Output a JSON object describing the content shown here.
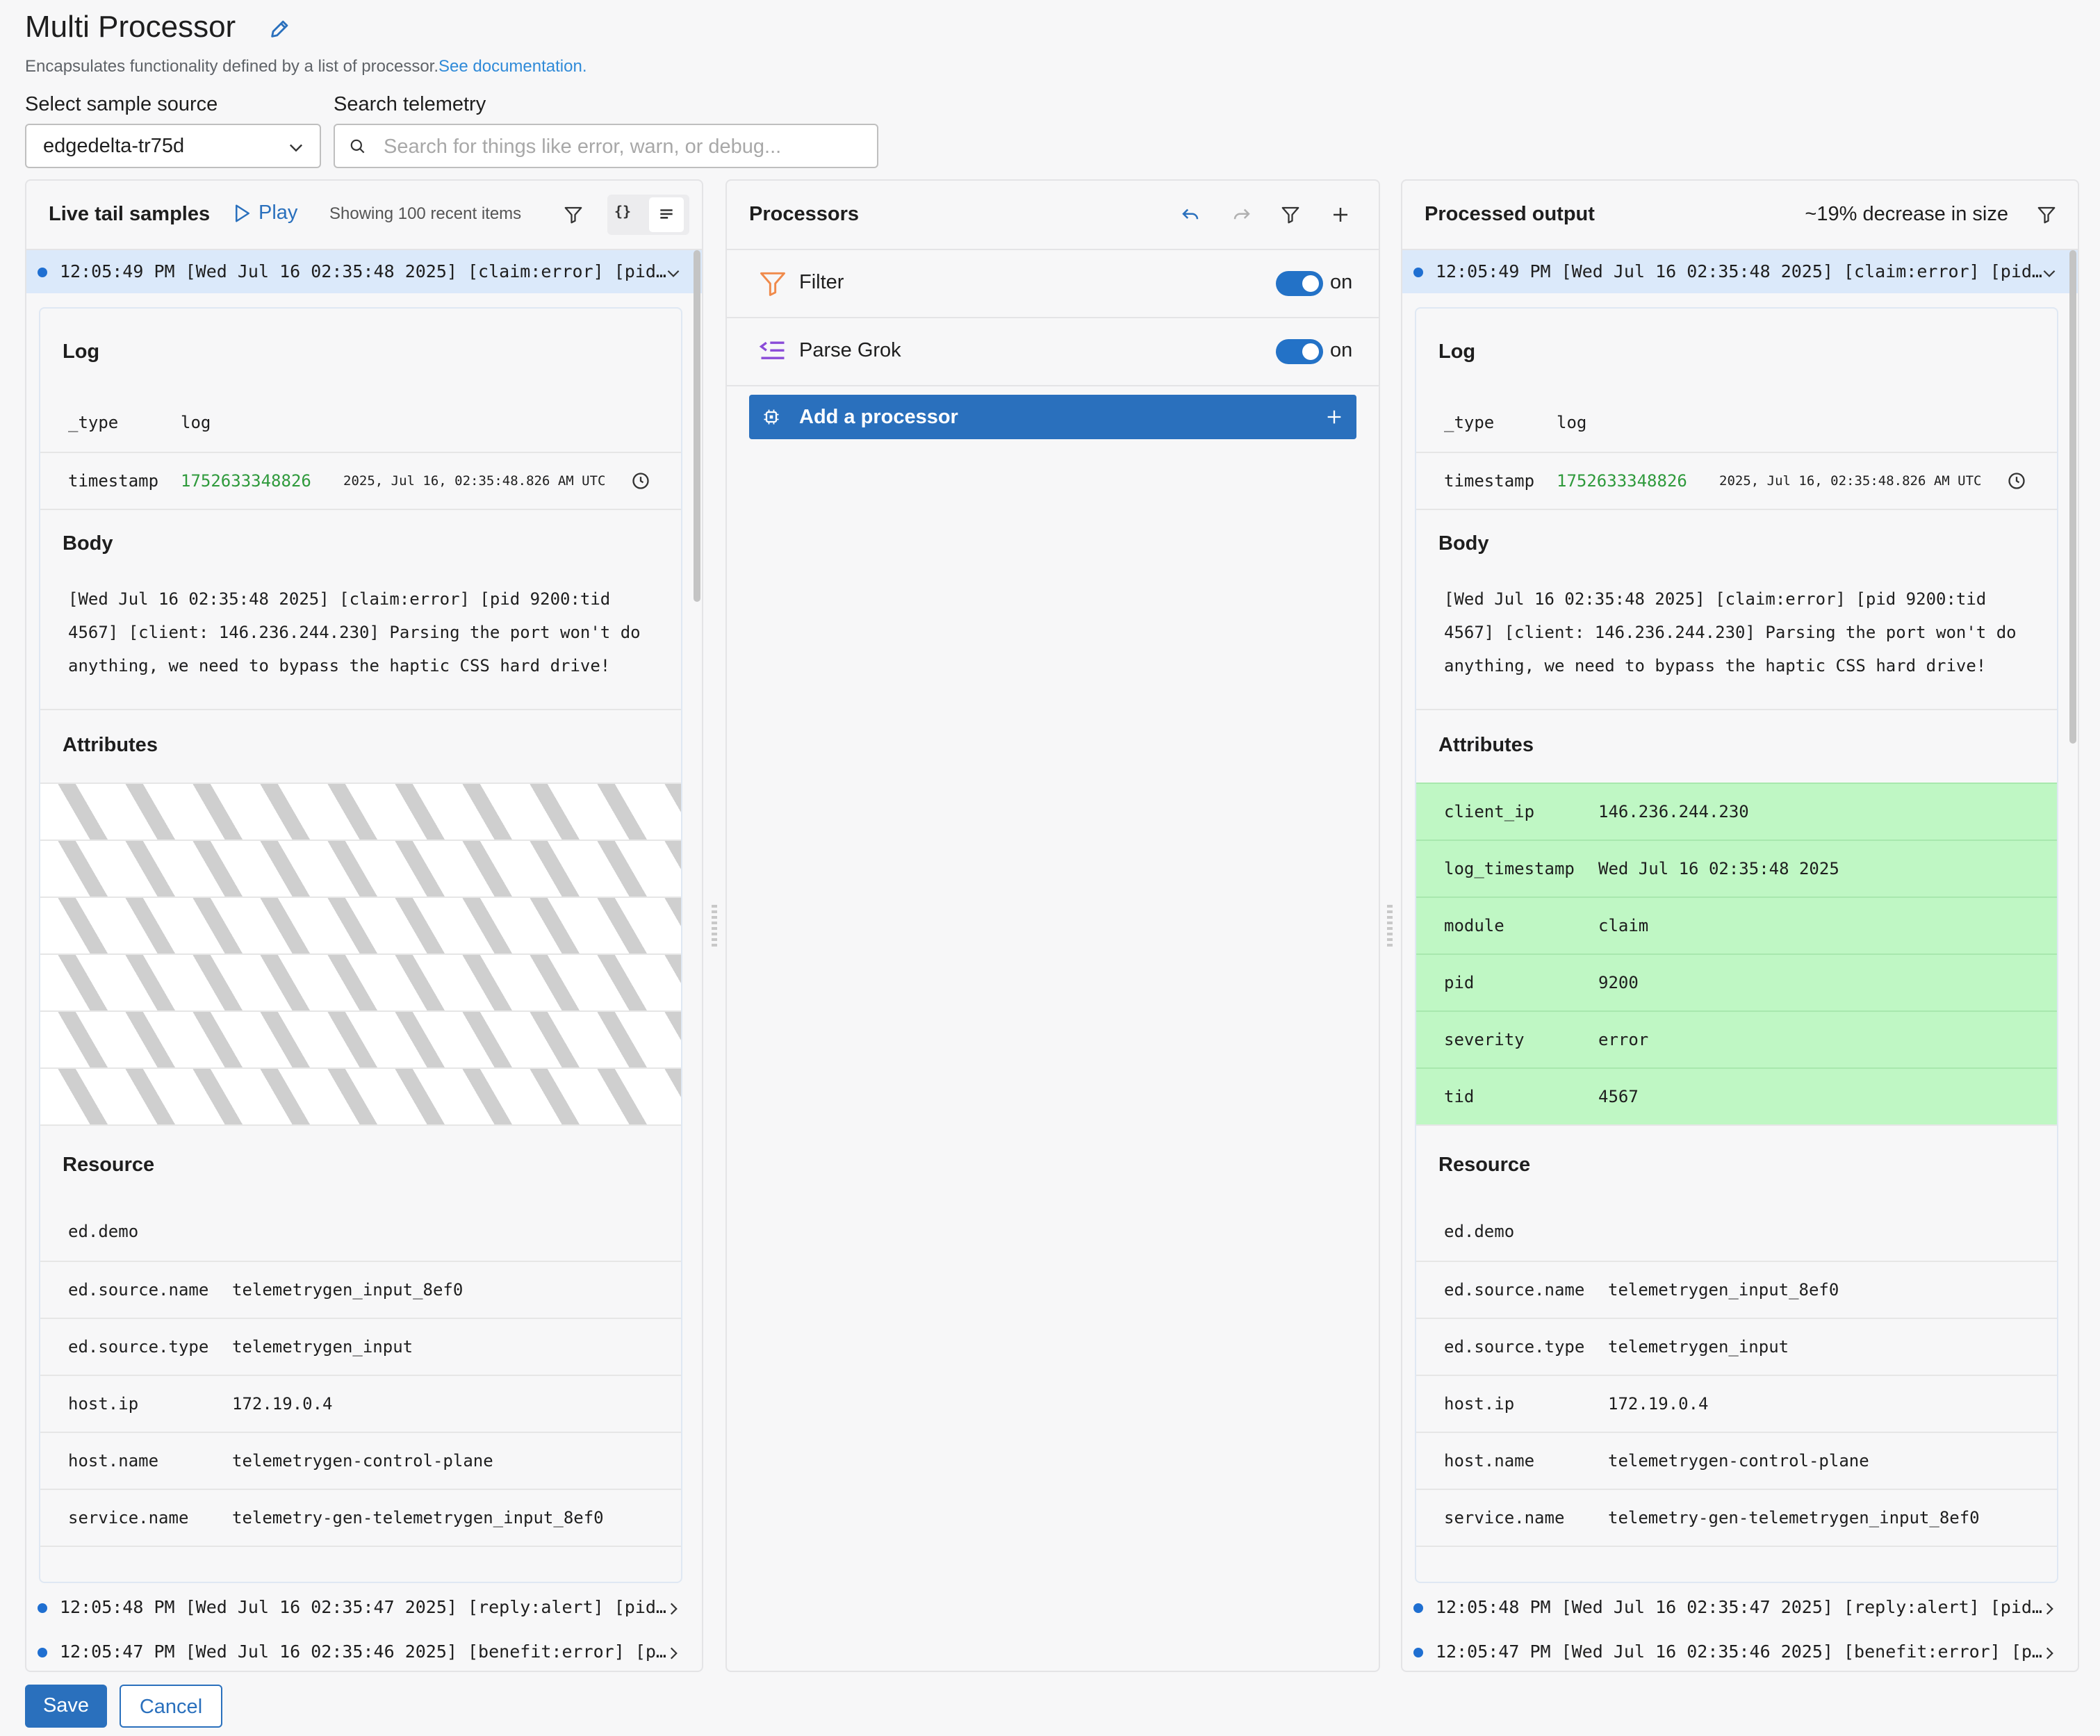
{
  "header": {
    "title": "Multi Processor",
    "subtitle": "Encapsulates functionality defined by a list of processor.",
    "doc_link": "See documentation.",
    "source_label": "Select sample source",
    "source_value": "edgedelta-tr75d",
    "search_label": "Search telemetry",
    "search_placeholder": "Search for things like error, warn, or debug..."
  },
  "left": {
    "title": "Live tail samples",
    "play": "Play",
    "count": "Showing 100 recent items",
    "samples": [
      "12:05:49 PM [Wed Jul 16 02:35:48 2025] [claim:error] [pid…",
      "12:05:48 PM [Wed Jul 16 02:35:47 2025] [reply:alert] [pid…",
      "12:05:47 PM [Wed Jul 16 02:35:46 2025] [benefit:error] [p…"
    ]
  },
  "middle": {
    "title": "Processors",
    "processors": [
      {
        "name": "Filter",
        "state": "on"
      },
      {
        "name": "Parse Grok",
        "state": "on"
      }
    ],
    "add_label": "Add a processor"
  },
  "right": {
    "title": "Processed output",
    "size_change": "~19% decrease in size",
    "samples": [
      "12:05:49 PM [Wed Jul 16 02:35:48 2025] [claim:error] [pid…",
      "12:05:48 PM [Wed Jul 16 02:35:47 2025] [reply:alert] [pid…",
      "12:05:47 PM [Wed Jul 16 02:35:46 2025] [benefit:error] [p…"
    ],
    "attributes": [
      {
        "k": "client_ip",
        "v": "146.236.244.230"
      },
      {
        "k": "log_timestamp",
        "v": "Wed Jul 16 02:35:48 2025"
      },
      {
        "k": "module",
        "v": "claim"
      },
      {
        "k": "pid",
        "v": "9200"
      },
      {
        "k": "severity",
        "v": "error"
      },
      {
        "k": "tid",
        "v": "4567"
      }
    ]
  },
  "log": {
    "section_log": "Log",
    "type_k": "_type",
    "type_v": "log",
    "ts_k": "timestamp",
    "ts_v": "1752633348826",
    "ts_human": "2025, Jul 16, 02:35:48.826 AM UTC",
    "section_body": "Body",
    "body": "[Wed Jul 16 02:35:48 2025] [claim:error] [pid 9200:tid 4567] [client: 146.236.244.230] Parsing the port won't do anything, we need to bypass the haptic CSS hard drive!",
    "section_attributes": "Attributes",
    "section_resource": "Resource",
    "resource": [
      {
        "k": "ed.demo",
        "v": ""
      },
      {
        "k": "ed.source.name",
        "v": "telemetrygen_input_8ef0"
      },
      {
        "k": "ed.source.type",
        "v": "telemetrygen_input"
      },
      {
        "k": "host.ip",
        "v": "172.19.0.4"
      },
      {
        "k": "host.name",
        "v": "telemetrygen-control-plane"
      },
      {
        "k": "service.name",
        "v": "telemetry-gen-telemetrygen_input_8ef0"
      }
    ]
  },
  "footer": {
    "save": "Save",
    "cancel": "Cancel"
  },
  "colors": {
    "accent": "#2a70bd",
    "highlight": "#bff7c4",
    "active_row": "#dbe9fa"
  }
}
